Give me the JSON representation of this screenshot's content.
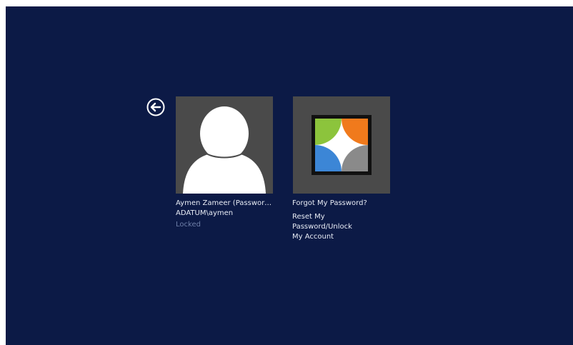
{
  "back_button": {
    "icon": "arrow-left-circle-icon"
  },
  "user_tile": {
    "name": "Aymen Zameer (PasswordC...",
    "domain_user": "ADATUM\\aymen",
    "status": "Locked",
    "icon": "default-user-avatar-icon"
  },
  "forgot_tile": {
    "title": "Forgot My Password?",
    "description_line1": "Reset My Password/Unlock",
    "description_line2": "My Account",
    "icon": "password-reset-portal-logo"
  },
  "colors": {
    "background": "#0c1a46",
    "tile": "#4a4a4a",
    "logo_green": "#8cc43c",
    "logo_orange": "#f07a1c",
    "logo_blue": "#3c86d6",
    "logo_gray": "#8a8a8a"
  }
}
